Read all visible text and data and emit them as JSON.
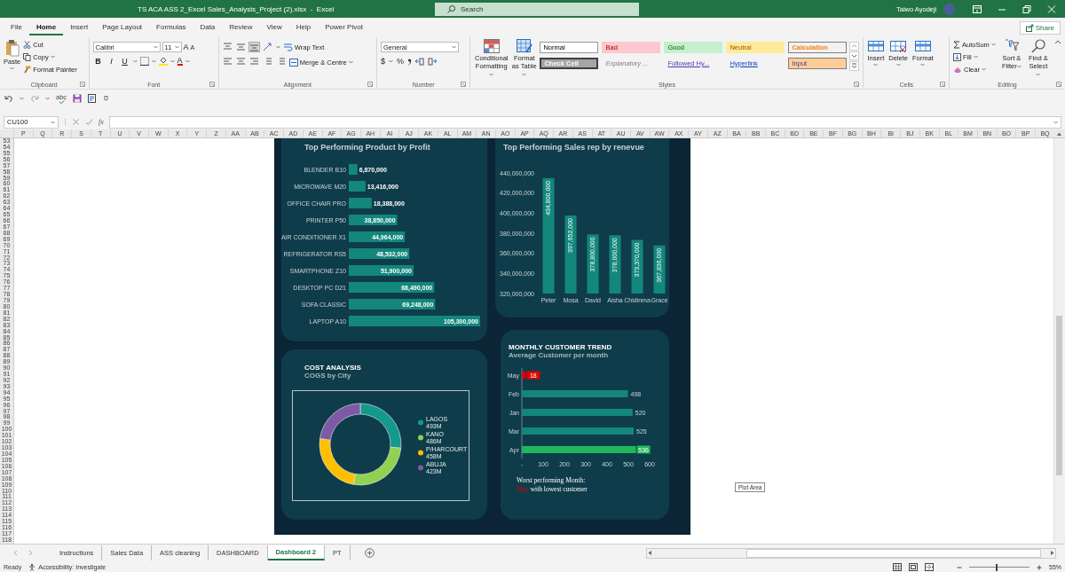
{
  "window": {
    "title": "TS ACA ASS 2_Excel Sales_Analysis_Project (2).xlsx  -  Excel",
    "search_placeholder": "Search",
    "user": "Taiwo Ayodeji"
  },
  "menu_tabs": [
    {
      "label": "File",
      "selected": false
    },
    {
      "label": "Home",
      "selected": true
    },
    {
      "label": "Insert",
      "selected": false
    },
    {
      "label": "Page Layout",
      "selected": false
    },
    {
      "label": "Formulas",
      "selected": false
    },
    {
      "label": "Data",
      "selected": false
    },
    {
      "label": "Review",
      "selected": false
    },
    {
      "label": "View",
      "selected": false
    },
    {
      "label": "Help",
      "selected": false
    },
    {
      "label": "Power Pivot",
      "selected": false
    }
  ],
  "share": "Share",
  "ribbon": {
    "clipboard": {
      "paste": "Paste",
      "cut": "Cut",
      "copy": "Copy",
      "format_painter": "Format Painter",
      "label": "Clipboard"
    },
    "font": {
      "name": "Calibri",
      "size": "11",
      "grow": "A",
      "shrink": "A",
      "bold": "B",
      "italic": "I",
      "underline": "U",
      "font_color": "A",
      "label": "Font"
    },
    "alignment": {
      "wrap": "Wrap Text",
      "merge": "Merge & Centre",
      "label": "Alignment"
    },
    "number": {
      "format": "General",
      "currency": "$",
      "percent": "%",
      "label": "Number"
    },
    "styles": {
      "conditional": "Conditional Formatting",
      "format_table": "Format as Table",
      "label": "Styles",
      "cells": [
        {
          "label": "Normal",
          "kind": "normal"
        },
        {
          "label": "Bad",
          "kind": "bad"
        },
        {
          "label": "Good",
          "kind": "good"
        },
        {
          "label": "Neutral",
          "kind": "neutral"
        },
        {
          "label": "Calculation",
          "kind": "calculation"
        },
        {
          "label": "Check Cell",
          "kind": "check"
        },
        {
          "label": "Explanatory ...",
          "kind": "explanatory"
        },
        {
          "label": "Followed Hy...",
          "kind": "followed"
        },
        {
          "label": "Hyperlink",
          "kind": "hyperlink"
        },
        {
          "label": "Input",
          "kind": "input"
        }
      ]
    },
    "cells": {
      "buttons": [
        "Insert",
        "Delete",
        "Format"
      ],
      "label": "Cells"
    },
    "editing": {
      "autosum": "AutoSum",
      "fill": "Fill",
      "clear": "Clear",
      "sort": "Sort & Filter",
      "find": "Find & Select",
      "label": "Editing"
    }
  },
  "quick_access": {
    "spelling": "abc"
  },
  "formula_bar": {
    "name_box": "CU100",
    "fx": "fx"
  },
  "column_headers": [
    "P",
    "Q",
    "R",
    "S",
    "T",
    "U",
    "V",
    "W",
    "X",
    "Y",
    "Z",
    "AA",
    "AB",
    "AC",
    "AD",
    "AE",
    "AF",
    "AG",
    "AH",
    "AI",
    "AJ",
    "AK",
    "AL",
    "AM",
    "AN",
    "AO",
    "AP",
    "AQ",
    "AR",
    "AS",
    "AT",
    "AU",
    "AV",
    "AW",
    "AX",
    "AY",
    "AZ",
    "BA",
    "BB",
    "BC",
    "BD",
    "BE",
    "BF",
    "BG",
    "BH",
    "BI",
    "BJ",
    "BK",
    "BL",
    "BM",
    "BN",
    "BO",
    "BP",
    "BQ"
  ],
  "row_numbers": [
    "53",
    "54",
    "55",
    "56",
    "57",
    "58",
    "59",
    "60",
    "61",
    "62",
    "63",
    "64",
    "65",
    "66",
    "67",
    "68",
    "69",
    "70",
    "71",
    "72",
    "73",
    "74",
    "75",
    "76",
    "77",
    "78",
    "79",
    "80",
    "81",
    "82",
    "83",
    "84",
    "85",
    "86",
    "87",
    "88",
    "89",
    "90",
    "91",
    "92",
    "93",
    "94",
    "95",
    "96",
    "97",
    "98",
    "99",
    "100",
    "101",
    "102",
    "103",
    "104",
    "105",
    "106",
    "107",
    "108",
    "109",
    "110",
    "111",
    "112",
    "113",
    "114",
    "115",
    "116",
    "117",
    "118"
  ],
  "dashboard": {
    "product_profit": {
      "title": "Top Performing Product by Profit",
      "chart_data": {
        "type": "bar",
        "orientation": "horizontal",
        "categories": [
          "BLENDER B10",
          "MICROWAVE M20",
          "OFFICE CHAIR PRO",
          "PRINTER P50",
          "AIR CONDITIONER X1",
          "REFRIGERATOR RS5",
          "SMARTPHONE Z10",
          "DESKTOP PC D21",
          "SOFA CLASSIC",
          "LAPTOP A10"
        ],
        "series": [
          {
            "color": "#13877c",
            "values": [
              6870000,
              13416000,
              18388000,
              38850000,
              44964000,
              48532000,
              51900000,
              68490000,
              69248000,
              105300000
            ],
            "value_labels": [
              "6,870,000",
              "13,416,000",
              "18,388,000",
              "38,850,000",
              "44,964,000",
              "48,532,000",
              "51,900,000",
              "68,490,000",
              "69,248,000",
              "105,300,000"
            ]
          }
        ],
        "data_labels": true
      }
    },
    "sales_rep": {
      "title": "Top Performing Sales rep by renevue",
      "chart_data": {
        "type": "bar",
        "categories": [
          "Peter",
          "Mosa",
          "David",
          "Aisha",
          "Chidinma",
          "Grace"
        ],
        "series": [
          {
            "color": "#13877c",
            "values": [
              434800000,
              397652000,
              378800000,
              378000000,
              373370000,
              367836000
            ],
            "value_labels": [
              "434,800,000",
              "397,652,000",
              "378,800,000",
              "378,000,000",
              "373,370,000",
              "367,836,000"
            ]
          }
        ],
        "ylim": [
          320000000,
          440000000
        ],
        "yticks": [
          {
            "value": 320000000,
            "label": "320,000,000"
          },
          {
            "value": 340000000,
            "label": "340,000,000"
          },
          {
            "value": 360000000,
            "label": "360,000,000"
          },
          {
            "value": 380000000,
            "label": "380,000,000"
          },
          {
            "value": 400000000,
            "label": "400,000,000"
          },
          {
            "value": 420000000,
            "label": "420,000,000"
          },
          {
            "value": 440000000,
            "label": "440,000,000"
          }
        ],
        "data_labels": true
      }
    },
    "cost": {
      "title": "COST ANALYSIS",
      "subtitle": "COGS by City",
      "chart_data": {
        "type": "donut",
        "categories": [
          "LAGOS",
          "KANO",
          "P/HARCOURT",
          "ABUJA"
        ],
        "values": [
          493,
          486,
          458,
          423
        ],
        "value_labels": [
          "493M",
          "486M",
          "458M",
          "423M"
        ],
        "colors": [
          "#139a8c",
          "#92d050",
          "#ffc000",
          "#7e5aa6"
        ],
        "legend": "right"
      }
    },
    "customers": {
      "title": "MONTHLY CUSTOMER TREND",
      "subtitle": "Average Customer per month",
      "chart_data": {
        "type": "bar",
        "orientation": "horizontal",
        "categories": [
          "May",
          "Feb",
          "Jan",
          "Mar",
          "Apr"
        ],
        "series": [
          {
            "values": [
              18,
              498,
              520,
              525,
              536
            ]
          }
        ],
        "xlim": [
          0,
          600
        ],
        "xticks": [
          {
            "value": 0,
            "label": "-"
          },
          {
            "value": 100,
            "label": "100"
          },
          {
            "value": 200,
            "label": "200"
          },
          {
            "value": 300,
            "label": "300"
          },
          {
            "value": 400,
            "label": "400"
          },
          {
            "value": 500,
            "label": "500"
          },
          {
            "value": 600,
            "label": "600"
          }
        ],
        "data_labels": true,
        "value_labels": [
          "18",
          "498",
          "520",
          "525",
          "536"
        ]
      },
      "bars": [
        {
          "color": "#e00000",
          "boxed_label": true
        },
        {
          "color": "#13877c",
          "boxed_label": false
        },
        {
          "color": "#13877c",
          "boxed_label": false
        },
        {
          "color": "#13877c",
          "boxed_label": false
        },
        {
          "color": "#1fb75a",
          "boxed_label": true
        }
      ]
    },
    "worst": {
      "line1": "Worst performing Month:",
      "month": "May",
      "line2": "with lowest customer"
    }
  },
  "tooltip": "Plot Area",
  "sheet_tabs": [
    {
      "label": "Instructions",
      "selected": false
    },
    {
      "label": "Sales Data",
      "selected": false
    },
    {
      "label": "ASS cleaning",
      "selected": false
    },
    {
      "label": "DASHBOARD",
      "selected": false
    },
    {
      "label": "Dashboard 2",
      "selected": true
    },
    {
      "label": "PT",
      "selected": false
    }
  ],
  "status": {
    "ready": "Ready",
    "accessibility": "Accessibility: Investigate",
    "zoom": "55%",
    "zoom_slider": {
      "level": 0.45
    }
  }
}
